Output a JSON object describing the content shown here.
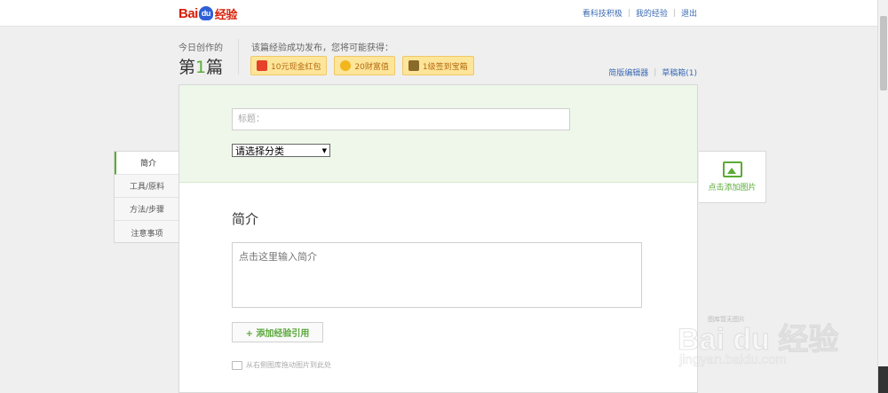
{
  "header": {
    "logo_text": "Bai",
    "logo_paw": "du",
    "logo_cn": "经验",
    "links": [
      "看科技积极",
      "我的经验",
      "退出"
    ]
  },
  "creation": {
    "today_label": "今日创作的",
    "count_prefix": "第",
    "count_num": "1",
    "count_suffix": "篇",
    "reward_tip": "该篇经验成功发布，您将可能获得：",
    "rewards": [
      {
        "label": "10元现金红包",
        "icon": "red-packet-icon"
      },
      {
        "label": "20财富值",
        "icon": "coin-icon"
      },
      {
        "label": "1级签到宝箱",
        "icon": "treasure-chest-icon"
      }
    ]
  },
  "editor_links": {
    "simple_editor": "简版编辑器",
    "drafts": "草稿箱(1)"
  },
  "form": {
    "title_placeholder": "标题：",
    "category_selected": "请选择分类",
    "section_title": "简介",
    "intro_placeholder": "点击这里输入简介",
    "add_ref_label": "+ 添加经验引用",
    "drag_tip": "从右侧图库拖动图片到此处"
  },
  "leftnav": {
    "items": [
      "简介",
      "工具/原料",
      "方法/步骤",
      "注意事项"
    ],
    "active": "简介"
  },
  "imgpanel": {
    "label": "点击添加图片",
    "gallery_tip": "图库暂无图片"
  },
  "watermark": {
    "line1": "Bai du 经验",
    "line2": "jingyan.baidu.com"
  },
  "colors": {
    "brand_red": "#d81e06",
    "accent_green": "#5aab36",
    "link_blue": "#3c6bb3",
    "head_bg": "#eef7ea",
    "reward_bg": "#fde59a"
  }
}
